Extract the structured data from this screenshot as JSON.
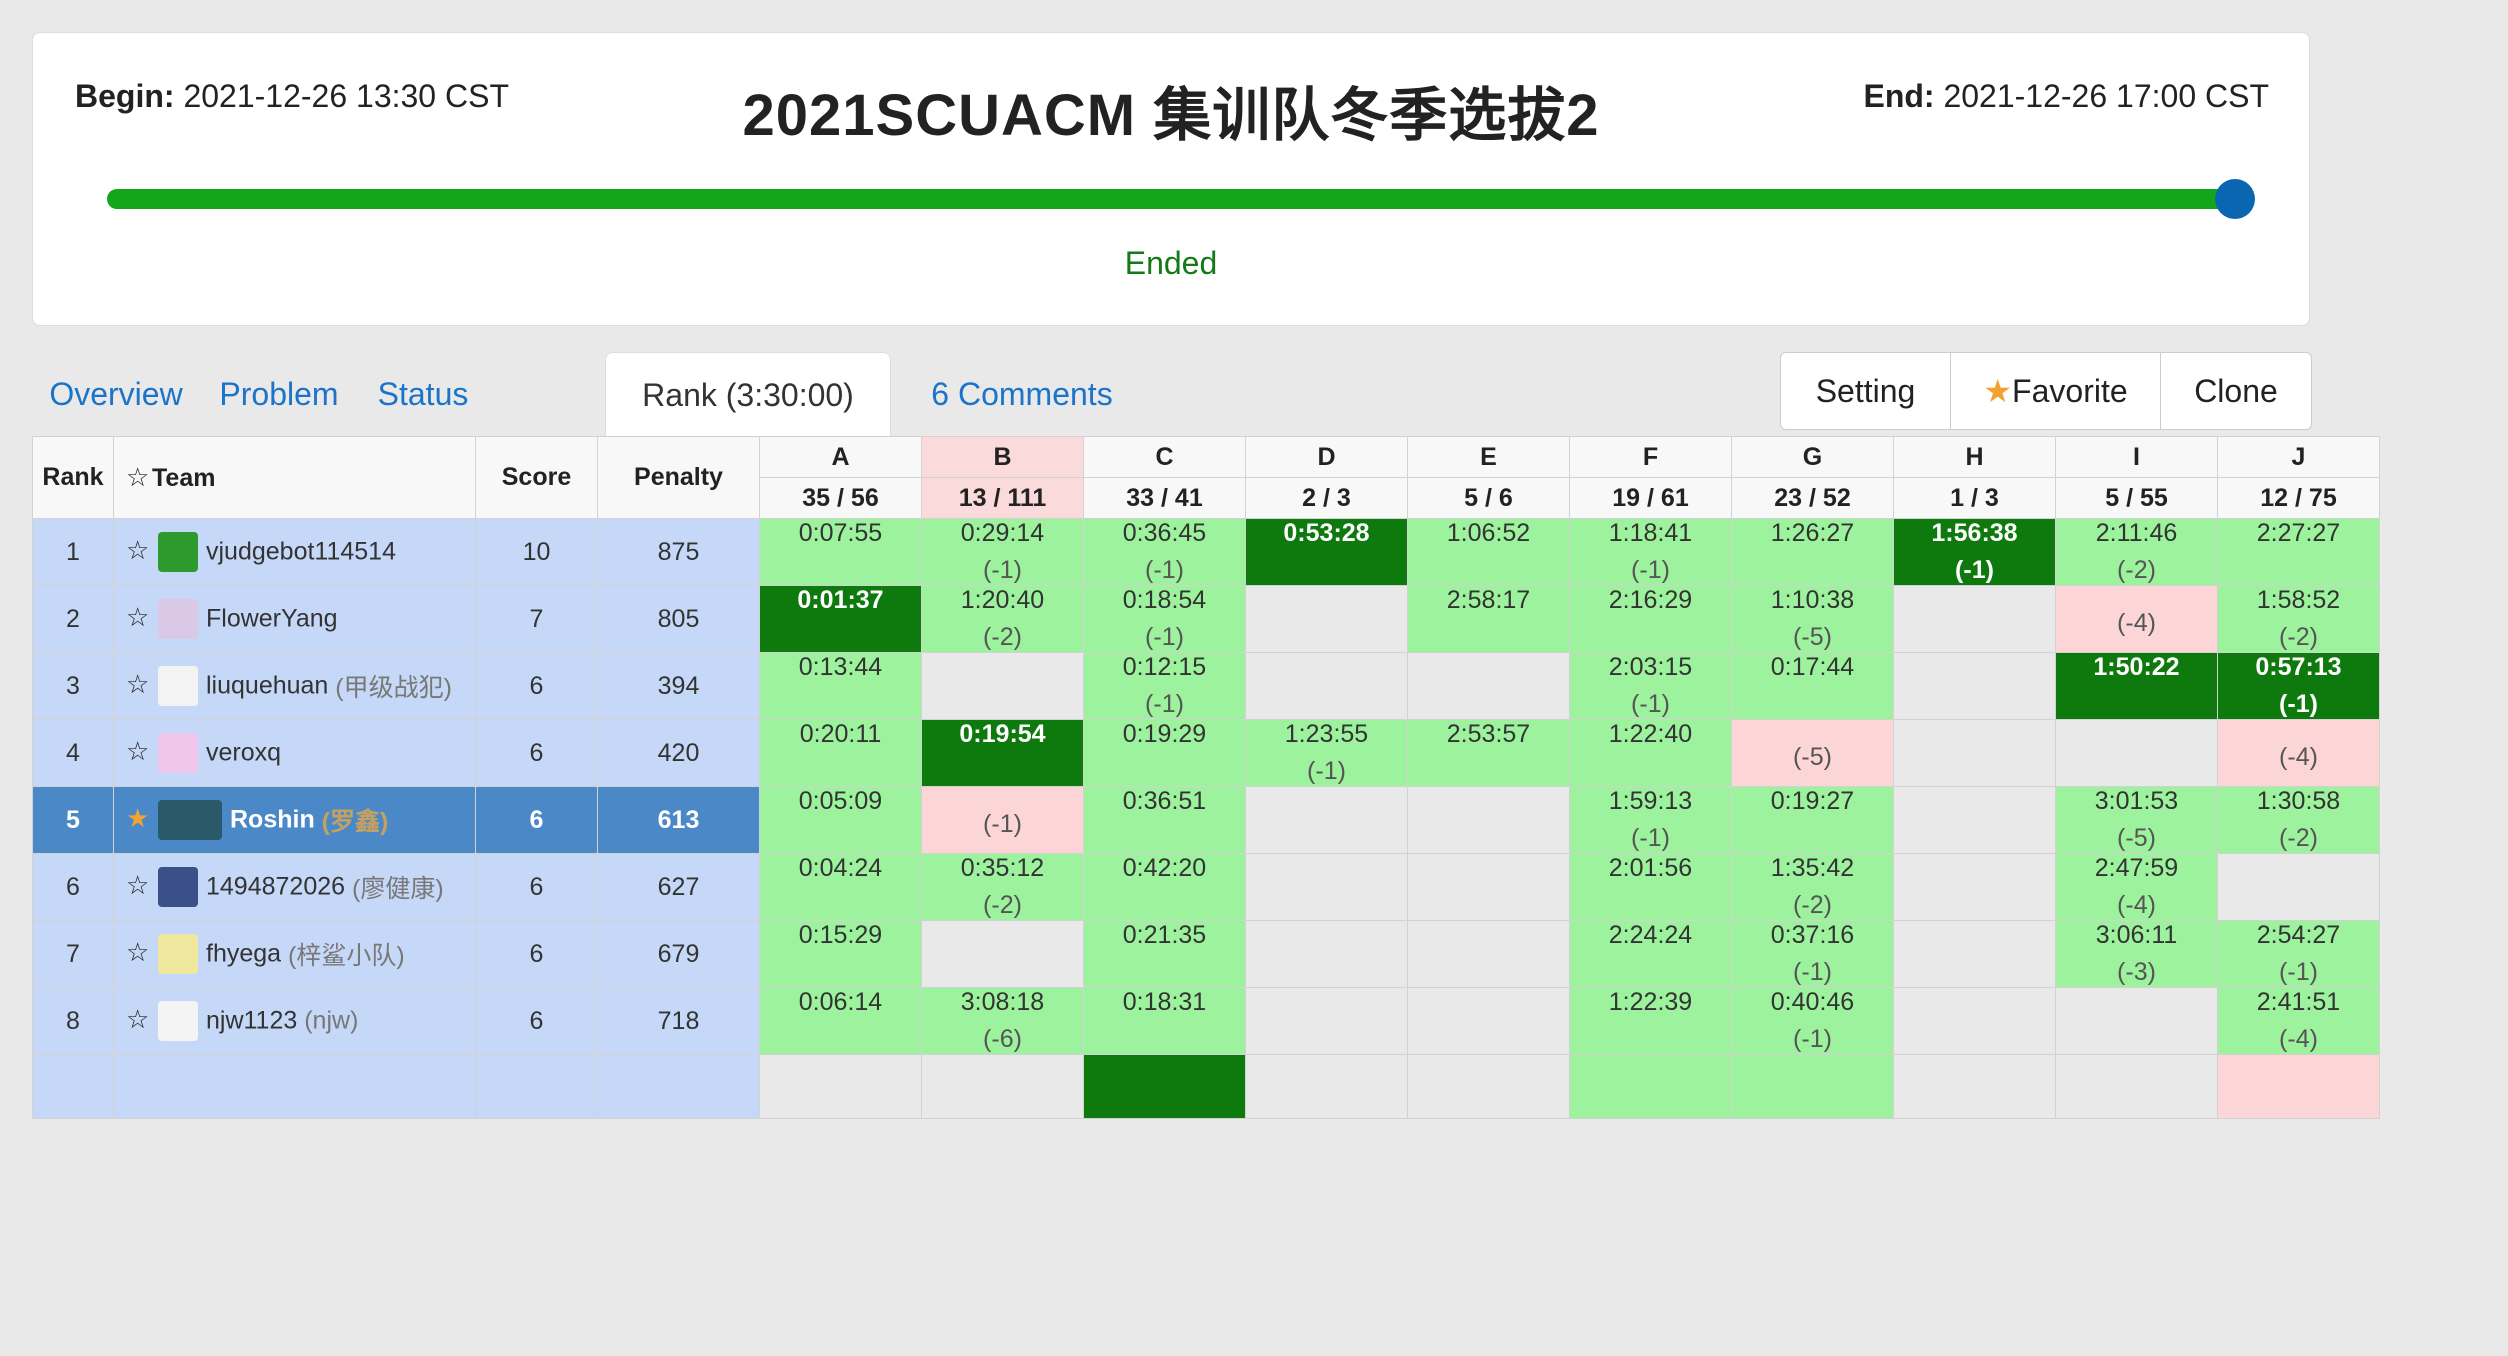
{
  "contest": {
    "begin_label": "Begin:",
    "begin_value": "2021-12-26 13:30 CST",
    "end_label": "End:",
    "end_value": "2021-12-26 17:00 CST",
    "title": "2021SCUACM 集训队冬季选拔2",
    "progress": 1.0,
    "status": "Ended"
  },
  "tabs": [
    {
      "label": "Overview"
    },
    {
      "label": "Problem"
    },
    {
      "label": "Status"
    },
    {
      "label": "Rank (3:30:00)",
      "active": true
    },
    {
      "label": "6 Comments"
    }
  ],
  "actions": {
    "setting": "Setting",
    "favorite": "Favorite",
    "clone": "Clone"
  },
  "columns": {
    "rank": "Rank",
    "team": "Team",
    "score": "Score",
    "penalty": "Penalty"
  },
  "problems": [
    {
      "id": "A",
      "stat": "35 / 56"
    },
    {
      "id": "B",
      "stat": "13 / 111"
    },
    {
      "id": "C",
      "stat": "33 / 41"
    },
    {
      "id": "D",
      "stat": "2 / 3"
    },
    {
      "id": "E",
      "stat": "5 / 6"
    },
    {
      "id": "F",
      "stat": "19 / 61"
    },
    {
      "id": "G",
      "stat": "23 / 52"
    },
    {
      "id": "H",
      "stat": "1 / 3"
    },
    {
      "id": "I",
      "stat": "5 / 55"
    },
    {
      "id": "J",
      "stat": "12 / 75"
    }
  ],
  "rows": [
    {
      "rank": "1",
      "name": "vjudgebot114514",
      "nick": "",
      "score": "10",
      "penalty": "875",
      "favorite": false,
      "mine": false,
      "cells": [
        {
          "s": "ac",
          "time": "0:07:55",
          "tries": ""
        },
        {
          "s": "ac",
          "time": "0:29:14",
          "tries": "(-1)"
        },
        {
          "s": "ac",
          "time": "0:36:45",
          "tries": "(-1)"
        },
        {
          "s": "fb",
          "time": "0:53:28",
          "tries": ""
        },
        {
          "s": "ac",
          "time": "1:06:52",
          "tries": ""
        },
        {
          "s": "ac",
          "time": "1:18:41",
          "tries": "(-1)"
        },
        {
          "s": "ac",
          "time": "1:26:27",
          "tries": ""
        },
        {
          "s": "fb",
          "time": "1:56:38",
          "tries": "(-1)"
        },
        {
          "s": "ac",
          "time": "2:11:46",
          "tries": "(-2)"
        },
        {
          "s": "ac",
          "time": "2:27:27",
          "tries": ""
        }
      ]
    },
    {
      "rank": "2",
      "name": "FlowerYang",
      "nick": "",
      "score": "7",
      "penalty": "805",
      "favorite": false,
      "mine": false,
      "cells": [
        {
          "s": "fb",
          "time": "0:01:37",
          "tries": ""
        },
        {
          "s": "ac",
          "time": "1:20:40",
          "tries": "(-2)"
        },
        {
          "s": "ac",
          "time": "0:18:54",
          "tries": "(-1)"
        },
        {
          "s": "none",
          "time": "",
          "tries": ""
        },
        {
          "s": "ac",
          "time": "2:58:17",
          "tries": ""
        },
        {
          "s": "ac",
          "time": "2:16:29",
          "tries": ""
        },
        {
          "s": "ac",
          "time": "1:10:38",
          "tries": "(-5)"
        },
        {
          "s": "none",
          "time": "",
          "tries": ""
        },
        {
          "s": "fail",
          "time": "",
          "tries": "(-4)"
        },
        {
          "s": "ac",
          "time": "1:58:52",
          "tries": "(-2)"
        }
      ]
    },
    {
      "rank": "3",
      "name": "liuquehuan",
      "nick": "(甲级战犯)",
      "score": "6",
      "penalty": "394",
      "favorite": false,
      "mine": false,
      "cells": [
        {
          "s": "ac",
          "time": "0:13:44",
          "tries": ""
        },
        {
          "s": "none",
          "time": "",
          "tries": ""
        },
        {
          "s": "ac",
          "time": "0:12:15",
          "tries": "(-1)"
        },
        {
          "s": "none",
          "time": "",
          "tries": ""
        },
        {
          "s": "none",
          "time": "",
          "tries": ""
        },
        {
          "s": "ac",
          "time": "2:03:15",
          "tries": "(-1)"
        },
        {
          "s": "ac",
          "time": "0:17:44",
          "tries": ""
        },
        {
          "s": "none",
          "time": "",
          "tries": ""
        },
        {
          "s": "fb",
          "time": "1:50:22",
          "tries": ""
        },
        {
          "s": "fb",
          "time": "0:57:13",
          "tries": "(-1)"
        }
      ]
    },
    {
      "rank": "4",
      "name": "veroxq",
      "nick": "",
      "score": "6",
      "penalty": "420",
      "favorite": false,
      "mine": false,
      "cells": [
        {
          "s": "ac",
          "time": "0:20:11",
          "tries": ""
        },
        {
          "s": "fb",
          "time": "0:19:54",
          "tries": ""
        },
        {
          "s": "ac",
          "time": "0:19:29",
          "tries": ""
        },
        {
          "s": "ac",
          "time": "1:23:55",
          "tries": "(-1)"
        },
        {
          "s": "ac",
          "time": "2:53:57",
          "tries": ""
        },
        {
          "s": "ac",
          "time": "1:22:40",
          "tries": ""
        },
        {
          "s": "fail",
          "time": "",
          "tries": "(-5)"
        },
        {
          "s": "none",
          "time": "",
          "tries": ""
        },
        {
          "s": "none",
          "time": "",
          "tries": ""
        },
        {
          "s": "fail",
          "time": "",
          "tries": "(-4)"
        }
      ]
    },
    {
      "rank": "5",
      "name": "Roshin",
      "nick": "(罗鑫)",
      "score": "6",
      "penalty": "613",
      "favorite": true,
      "mine": true,
      "cells": [
        {
          "s": "ac",
          "time": "0:05:09",
          "tries": ""
        },
        {
          "s": "fail",
          "time": "",
          "tries": "(-1)"
        },
        {
          "s": "ac",
          "time": "0:36:51",
          "tries": ""
        },
        {
          "s": "none",
          "time": "",
          "tries": ""
        },
        {
          "s": "none",
          "time": "",
          "tries": ""
        },
        {
          "s": "ac",
          "time": "1:59:13",
          "tries": "(-1)"
        },
        {
          "s": "ac",
          "time": "0:19:27",
          "tries": ""
        },
        {
          "s": "none",
          "time": "",
          "tries": ""
        },
        {
          "s": "ac",
          "time": "3:01:53",
          "tries": "(-5)"
        },
        {
          "s": "ac",
          "time": "1:30:58",
          "tries": "(-2)"
        }
      ]
    },
    {
      "rank": "6",
      "name": "1494872026",
      "nick": "(廖健康)",
      "score": "6",
      "penalty": "627",
      "favorite": false,
      "mine": false,
      "cells": [
        {
          "s": "ac",
          "time": "0:04:24",
          "tries": ""
        },
        {
          "s": "ac",
          "time": "0:35:12",
          "tries": "(-2)"
        },
        {
          "s": "ac",
          "time": "0:42:20",
          "tries": ""
        },
        {
          "s": "none",
          "time": "",
          "tries": ""
        },
        {
          "s": "none",
          "time": "",
          "tries": ""
        },
        {
          "s": "ac",
          "time": "2:01:56",
          "tries": ""
        },
        {
          "s": "ac",
          "time": "1:35:42",
          "tries": "(-2)"
        },
        {
          "s": "none",
          "time": "",
          "tries": ""
        },
        {
          "s": "ac",
          "time": "2:47:59",
          "tries": "(-4)"
        },
        {
          "s": "none",
          "time": "",
          "tries": ""
        }
      ]
    },
    {
      "rank": "7",
      "name": "fhyega",
      "nick": "(梓鲨小队)",
      "score": "6",
      "penalty": "679",
      "favorite": false,
      "mine": false,
      "cells": [
        {
          "s": "ac",
          "time": "0:15:29",
          "tries": ""
        },
        {
          "s": "none",
          "time": "",
          "tries": ""
        },
        {
          "s": "ac",
          "time": "0:21:35",
          "tries": ""
        },
        {
          "s": "none",
          "time": "",
          "tries": ""
        },
        {
          "s": "none",
          "time": "",
          "tries": ""
        },
        {
          "s": "ac",
          "time": "2:24:24",
          "tries": ""
        },
        {
          "s": "ac",
          "time": "0:37:16",
          "tries": "(-1)"
        },
        {
          "s": "none",
          "time": "",
          "tries": ""
        },
        {
          "s": "ac",
          "time": "3:06:11",
          "tries": "(-3)"
        },
        {
          "s": "ac",
          "time": "2:54:27",
          "tries": "(-1)"
        }
      ]
    },
    {
      "rank": "8",
      "name": "njw1123",
      "nick": "(njw)",
      "score": "6",
      "penalty": "718",
      "favorite": false,
      "mine": false,
      "cells": [
        {
          "s": "ac",
          "time": "0:06:14",
          "tries": ""
        },
        {
          "s": "ac",
          "time": "3:08:18",
          "tries": "(-6)"
        },
        {
          "s": "ac",
          "time": "0:18:31",
          "tries": ""
        },
        {
          "s": "none",
          "time": "",
          "tries": ""
        },
        {
          "s": "none",
          "time": "",
          "tries": ""
        },
        {
          "s": "ac",
          "time": "1:22:39",
          "tries": ""
        },
        {
          "s": "ac",
          "time": "0:40:46",
          "tries": "(-1)"
        },
        {
          "s": "none",
          "time": "",
          "tries": ""
        },
        {
          "s": "none",
          "time": "",
          "tries": ""
        },
        {
          "s": "ac",
          "time": "2:41:51",
          "tries": "(-4)"
        }
      ]
    },
    {
      "rank": "",
      "name": "",
      "nick": "",
      "score": "",
      "penalty": "",
      "favorite": false,
      "mine": false,
      "cells": [
        {
          "s": "none",
          "time": "",
          "tries": ""
        },
        {
          "s": "none",
          "time": "",
          "tries": ""
        },
        {
          "s": "fb",
          "time": "",
          "tries": ""
        },
        {
          "s": "none",
          "time": "",
          "tries": ""
        },
        {
          "s": "none",
          "time": "",
          "tries": ""
        },
        {
          "s": "ac",
          "time": "",
          "tries": ""
        },
        {
          "s": "ac",
          "time": "",
          "tries": ""
        },
        {
          "s": "none",
          "time": "",
          "tries": ""
        },
        {
          "s": "none",
          "time": "",
          "tries": ""
        },
        {
          "s": "fail",
          "time": "",
          "tries": ""
        }
      ]
    }
  ],
  "icons": {
    "star_empty": "☆",
    "star_filled": "★",
    "avatar": "avatar-image"
  },
  "colors": {
    "accepted": "#9df29d",
    "first_blood": "#0e7a0e",
    "failed": "#fcd6d6",
    "team_bg": "#c6d8f7",
    "my_team_bg": "#4b88c8",
    "progress": "#15a51b",
    "link": "#1b74c9"
  }
}
